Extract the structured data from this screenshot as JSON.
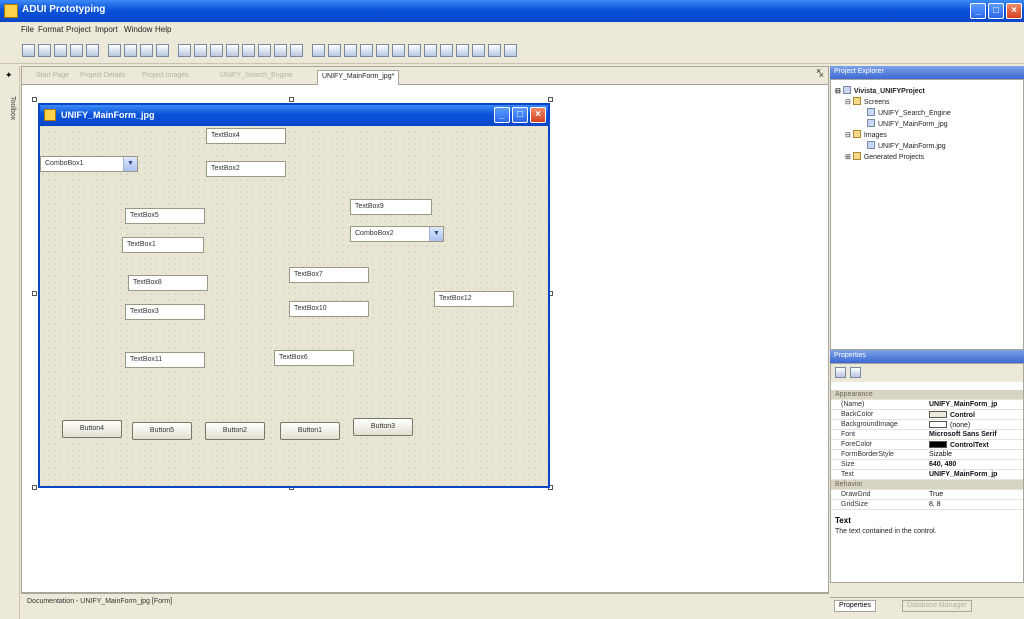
{
  "app": {
    "title": "ADUI Prototyping"
  },
  "menu": [
    "File",
    "Format",
    "Project",
    "Import",
    "Window",
    "Help"
  ],
  "toolbar_icons": [
    "new-icon",
    "open-icon",
    "save-icon",
    "save-all-icon",
    "cut-icon",
    "copy-icon",
    "paste-icon",
    "undo-icon",
    "redo-icon",
    "align-left-icon",
    "align-center-icon",
    "align-right-icon",
    "align-top-icon",
    "align-middle-icon",
    "align-bottom-icon",
    "same-width-icon",
    "same-height-icon",
    "same-size-icon",
    "grid-icon",
    "spacing-icon",
    "bring-front-icon",
    "send-back-icon",
    "order-icon",
    "lock-icon",
    "tab-order-icon",
    "zoom-icon",
    "preview-icon",
    "run-icon",
    "export-icon",
    "settings-icon"
  ],
  "sidebar": {
    "label": "Toolbox"
  },
  "tabs": [
    {
      "label": "Start Page",
      "active": false
    },
    {
      "label": "Project Details",
      "active": false
    },
    {
      "label": "Project Images",
      "active": false
    },
    {
      "label": "UNIFY_Search_Engine",
      "active": false
    },
    {
      "label": "UNIFY_MainForm_jpg*",
      "active": true
    }
  ],
  "form": {
    "title": "UNIFY_MainForm_jpg",
    "controls": {
      "textbox4": "TextBox4",
      "textbox2": "TextBox2",
      "combobox1": "ComboBox1",
      "textbox9": "TextBox9",
      "combobox2": "ComboBox2",
      "textbox5": "TextBox5",
      "textbox1": "TextBox1",
      "textbox7": "TextBox7",
      "textbox8": "TextBox8",
      "textbox12": "TextBox12",
      "textbox3": "TextBox3",
      "textbox10": "TextBox10",
      "textbox11": "TextBox11",
      "textbox6": "TextBox6",
      "button4": "Button4",
      "button5": "Button5",
      "button2": "Button2",
      "button1": "Button1",
      "button3": "Button3"
    }
  },
  "statusbar": {
    "text": "Documentation - UNIFY_MainForm_jpg [Form]"
  },
  "project_explorer": {
    "title": "Project Explorer",
    "root": "Vivista_UNIFYProject",
    "screens": "Screens",
    "screen1": "UNIFY_Search_Engine",
    "screen2": "UNIFY_MainForm_jpg",
    "images": "Images",
    "image1": "UNIFY_MainForm.jpg",
    "generated": "Generated Projects"
  },
  "properties": {
    "title": "Properties",
    "cat_appearance": "Appearance",
    "cat_behavior": "Behavior",
    "rows": [
      {
        "name": "(Name)",
        "value": "UNIFY_MainForm_jp"
      },
      {
        "name": "BackColor",
        "value": "Control"
      },
      {
        "name": "BackgroundImage",
        "value": "(none)"
      },
      {
        "name": "Font",
        "value": "Microsoft Sans Serif"
      },
      {
        "name": "ForeColor",
        "value": "ControlText"
      },
      {
        "name": "FormBorderStyle",
        "value": "Sizable"
      },
      {
        "name": "Size",
        "value": "640, 480"
      },
      {
        "name": "Text",
        "value": "UNIFY_MainForm_jp"
      },
      {
        "name": "DrawGrid",
        "value": "True"
      },
      {
        "name": "GridSize",
        "value": "8, 8"
      }
    ],
    "desc_title": "Text",
    "desc_text": "The text contained in the control."
  },
  "bottom_tabs": [
    "Properties",
    "Database Manager"
  ],
  "colors": {
    "xp_blue": "#0a46c8",
    "chrome": "#ece9d8"
  }
}
